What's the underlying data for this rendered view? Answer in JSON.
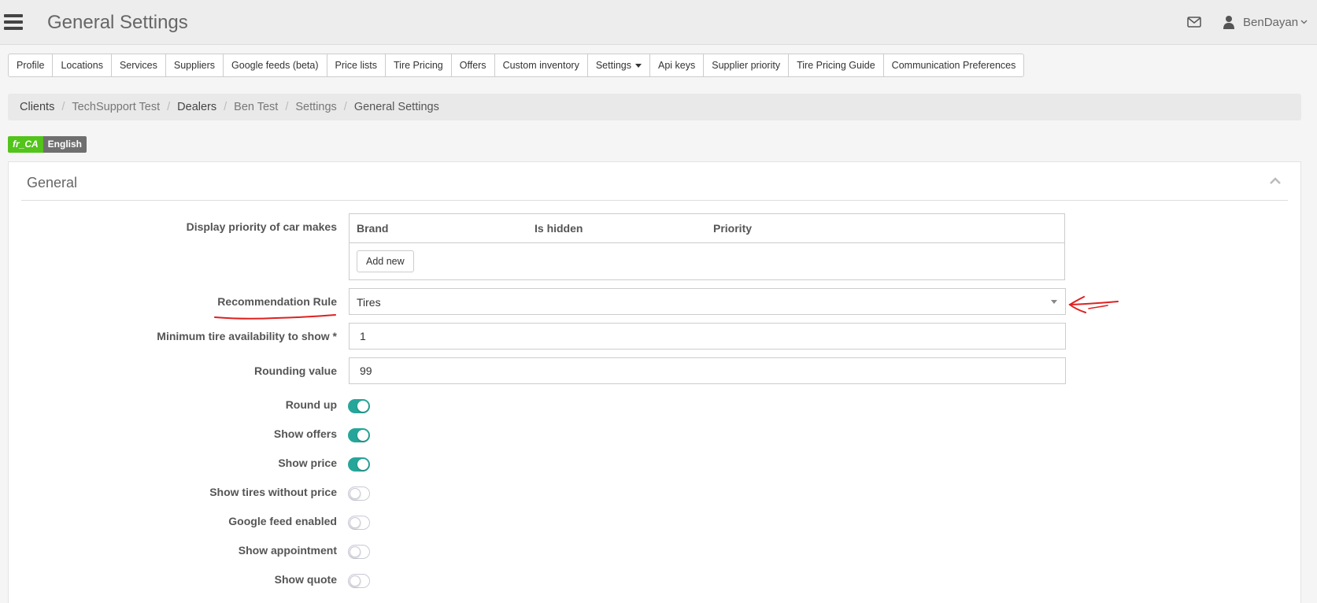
{
  "header": {
    "title": "General Settings",
    "mail_icon": "mail-icon",
    "user_icon": "user-icon",
    "username": "BenDayan"
  },
  "tabs": [
    {
      "label": "Profile"
    },
    {
      "label": "Locations"
    },
    {
      "label": "Services"
    },
    {
      "label": "Suppliers"
    },
    {
      "label": "Google feeds (beta)"
    },
    {
      "label": "Price lists"
    },
    {
      "label": "Tire Pricing"
    },
    {
      "label": "Offers"
    },
    {
      "label": "Custom inventory"
    },
    {
      "label": "Settings",
      "dropdown": true
    },
    {
      "label": "Api keys"
    },
    {
      "label": "Supplier priority"
    },
    {
      "label": "Tire Pricing Guide"
    },
    {
      "label": "Communication Preferences"
    }
  ],
  "breadcrumb": [
    "Clients",
    "TechSupport Test",
    "Dealers",
    "Ben Test",
    "Settings",
    "General Settings"
  ],
  "breadcrumb_separator": "/",
  "languages": {
    "alt": "fr_CA",
    "current": "English"
  },
  "panel": {
    "title": "General",
    "car_makes": {
      "label": "Display priority of car makes",
      "columns": [
        "Brand",
        "Is hidden",
        "Priority"
      ],
      "add_button": "Add new"
    },
    "recommendation_rule": {
      "label": "Recommendation Rule",
      "value": "Tires"
    },
    "min_availability": {
      "label": "Minimum tire availability to show *",
      "value": "1"
    },
    "rounding_value": {
      "label": "Rounding value",
      "value": "99"
    },
    "toggles": [
      {
        "label": "Round up",
        "on": true
      },
      {
        "label": "Show offers",
        "on": true
      },
      {
        "label": "Show price",
        "on": true
      },
      {
        "label": "Show tires without price",
        "on": false
      },
      {
        "label": "Google feed enabled",
        "on": false
      },
      {
        "label": "Show appointment",
        "on": false
      },
      {
        "label": "Show quote",
        "on": false
      }
    ]
  },
  "colors": {
    "toggle_on": "#26a69a",
    "lang_badge": "#52c41a",
    "annotation": "#e02020"
  }
}
